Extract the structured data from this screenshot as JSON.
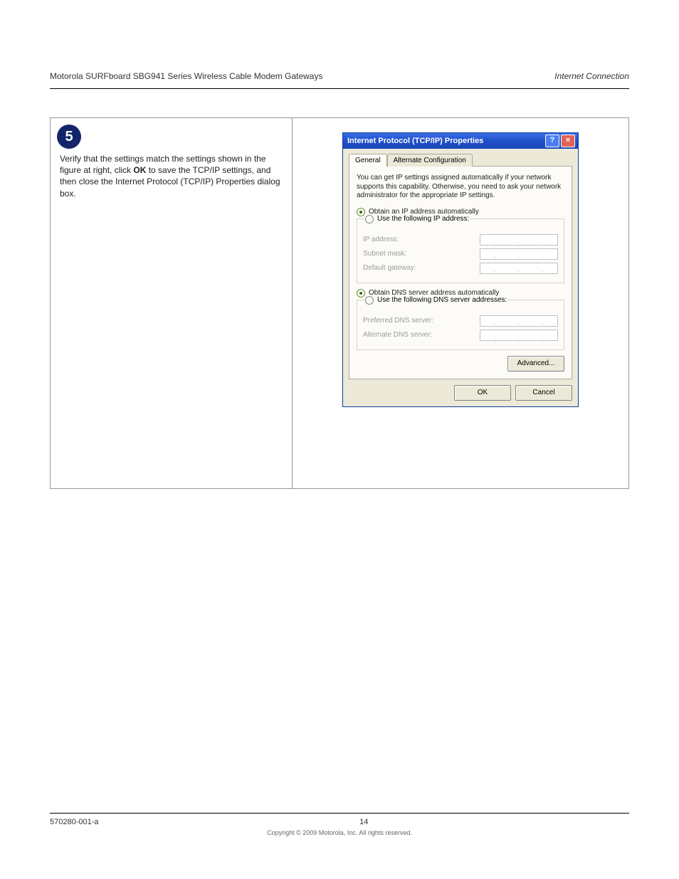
{
  "header": {
    "left": "Motorola SURFboard SBG941 Series Wireless Cable Modem Gateways",
    "right": "Internet Connection"
  },
  "step": {
    "number": "5",
    "text_before": "Verify that the settings match the settings shown in the figure at right, click ",
    "bold": "OK",
    "text_after": " to save the TCP/IP settings, and then close the Internet Protocol (TCP/IP) Properties dialog box."
  },
  "dialog": {
    "title": "Internet Protocol (TCP/IP) Properties",
    "help_btn": "?",
    "close_btn": "×",
    "tabs": {
      "general": "General",
      "alt": "Alternate Configuration"
    },
    "desc": "You can get IP settings assigned automatically if your network supports this capability. Otherwise, you need to ask your network administrator for the appropriate IP settings.",
    "radio_ip_auto": "Obtain an IP address automatically",
    "radio_ip_manual": "Use the following IP address:",
    "field_ip": "IP address:",
    "field_subnet": "Subnet mask:",
    "field_gateway": "Default gateway:",
    "radio_dns_auto": "Obtain DNS server address automatically",
    "radio_dns_manual": "Use the following DNS server addresses:",
    "field_pref_dns": "Preferred DNS server:",
    "field_alt_dns": "Alternate DNS server:",
    "btn_advanced": "Advanced...",
    "btn_ok": "OK",
    "btn_cancel": "Cancel"
  },
  "footer": {
    "left": "570280-001-a",
    "center": "14",
    "right": "",
    "copyright": "Copyright © 2009 Motorola, Inc. All rights reserved."
  }
}
